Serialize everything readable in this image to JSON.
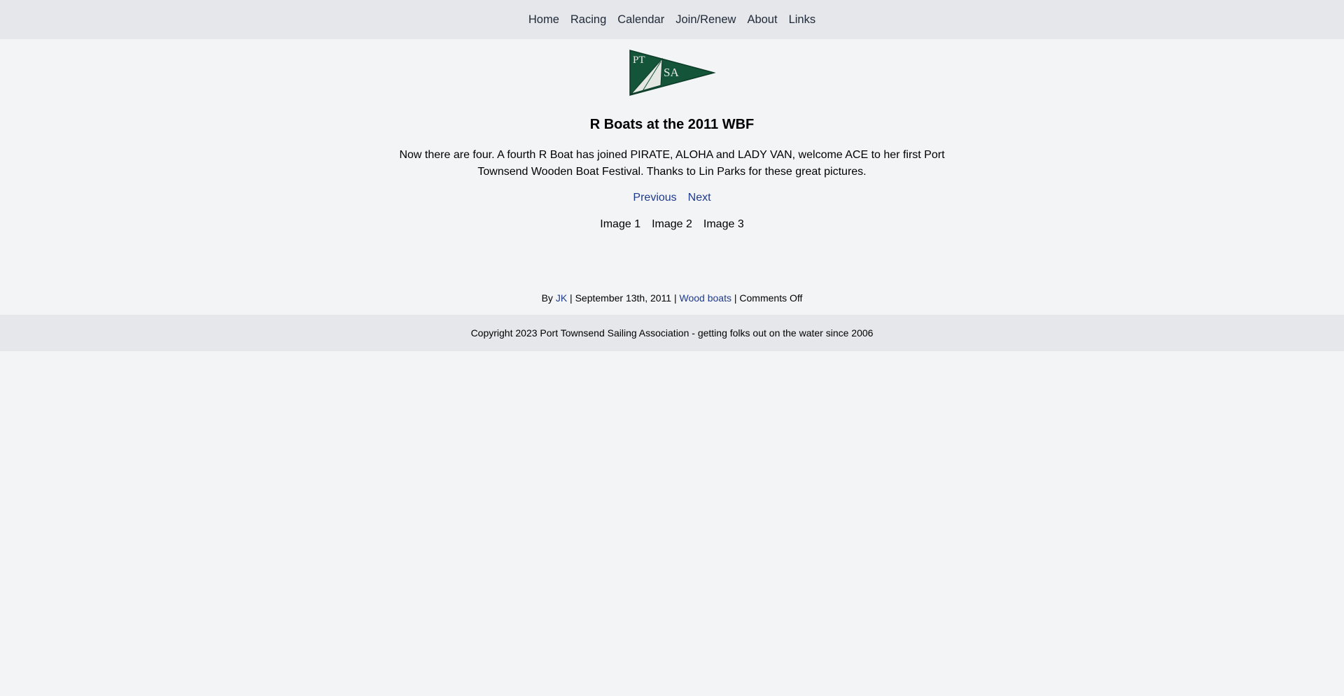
{
  "nav": {
    "items": [
      {
        "label": "Home"
      },
      {
        "label": "Racing"
      },
      {
        "label": "Calendar"
      },
      {
        "label": "Join/Renew"
      },
      {
        "label": "About"
      },
      {
        "label": "Links"
      }
    ]
  },
  "logo": {
    "text_top": "PT",
    "text_right": "SA",
    "colors": {
      "flag": "#14553a",
      "sail": "#e5e7e3"
    }
  },
  "post": {
    "title": "R Boats at the 2011 WBF",
    "description": "Now there are four. A fourth R Boat has joined PIRATE, ALOHA and LADY VAN, welcome ACE to her first Port Townsend Wooden Boat Festival. Thanks to Lin Parks for these great pictures.",
    "pager": {
      "previous": "Previous",
      "next": "Next"
    },
    "images": [
      "Image 1",
      "Image 2",
      "Image 3"
    ],
    "meta": {
      "by_prefix": "By",
      "author": "JK",
      "sep": "|",
      "date": "September 13th, 2011",
      "category": "Wood boats",
      "comments": "Comments Off"
    }
  },
  "footer": {
    "text": "Copyright 2023 Port Townsend Sailing Association - getting folks out on the water since 2006"
  },
  "colors": {
    "page_bg": "#f3f4f6",
    "bar_bg": "#e5e7eb",
    "link": "#1e3a8a"
  }
}
